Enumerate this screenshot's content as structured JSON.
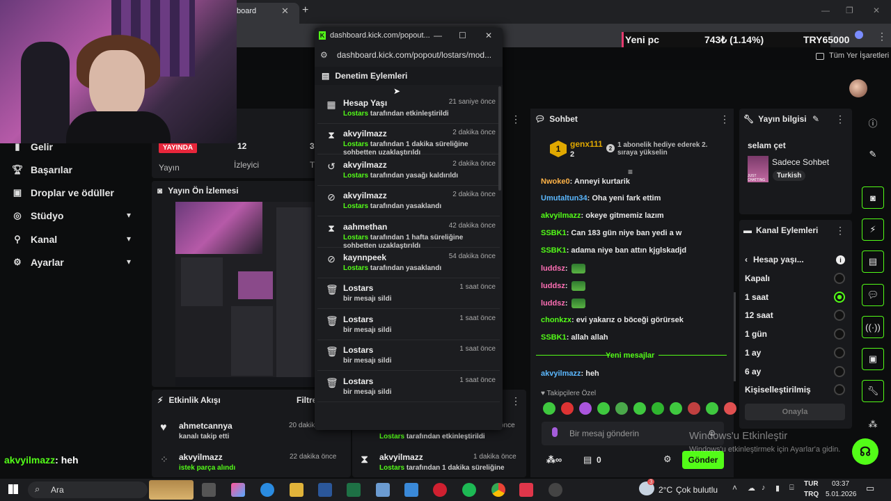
{
  "browser": {
    "tab_title": "board",
    "tab_close": "✕",
    "new_tab": "+",
    "bookmarks": "Tüm Yer İşaretleri"
  },
  "ticker": {
    "label": "Yeni pc",
    "value": "743₺ (1.14%)",
    "goal": "TRY65000"
  },
  "nav": [
    {
      "label": "Gelir",
      "icon": "income-icon"
    },
    {
      "label": "Başarılar",
      "icon": "trophy-icon"
    },
    {
      "label": "Droplar ve ödüller",
      "icon": "gift-icon"
    },
    {
      "label": "Stüdyo",
      "icon": "studio-icon"
    },
    {
      "label": "Kanal",
      "icon": "channel-icon"
    },
    {
      "label": "Ayarlar",
      "icon": "gear-icon"
    }
  ],
  "stats": {
    "live": "YAYINDA",
    "stream_label": "Yayın",
    "viewers_num": "12",
    "viewers_label": "İzleyici",
    "third_num": "3",
    "third_label": "T"
  },
  "preview": {
    "title": "Yayın Ön İzlemesi"
  },
  "activity": {
    "title": "Etkinlik Akışı",
    "filter": "Filtre",
    "items": [
      {
        "name": "ahmetcannya",
        "sub": "kanalı takip etti",
        "time": "20 dakika önce"
      },
      {
        "name": "akvyilmazz",
        "sub": "istek parça alındı",
        "time": "22 dakika önce"
      }
    ]
  },
  "overlay_chat": {
    "name": "akvyilmazz",
    "message": ": heh"
  },
  "popout": {
    "window_title": "dashboard.kick.com/popout...",
    "url": "dashboard.kick.com/popout/lostars/mod...",
    "header": "Denetim Eylemleri",
    "rows": [
      {
        "icon": "calendar-icon",
        "glyph": "▦",
        "name": "Hesap Yaşı",
        "time": "21 saniye önce",
        "actor": "Lostars",
        "sub": "tarafından etkinleştirildi"
      },
      {
        "icon": "hourglass-icon",
        "glyph": "⧗",
        "name": "akvyilmazz",
        "time": "2 dakika önce",
        "actor": "Lostars",
        "sub": "tarafından 1 dakika süreliğine sohbetten uzaklaştırıldı"
      },
      {
        "icon": "undo-icon",
        "glyph": "↺",
        "name": "akvyilmazz",
        "time": "2 dakika önce",
        "actor": "Lostars",
        "sub": "tarafından yasağı kaldırıldı"
      },
      {
        "icon": "ban-icon",
        "glyph": "⊘",
        "name": "akvyilmazz",
        "time": "2 dakika önce",
        "actor": "Lostars",
        "sub": "tarafından yasaklandı"
      },
      {
        "icon": "hourglass-icon",
        "glyph": "⧗",
        "name": "aahmethan",
        "time": "42 dakika önce",
        "actor": "Lostars",
        "sub": "tarafından 1 hafta süreliğine sohbetten uzaklaştırıldı"
      },
      {
        "icon": "ban-icon",
        "glyph": "⊘",
        "name": "kaynnpeek",
        "time": "54 dakika önce",
        "actor": "Lostars",
        "sub": "tarafından yasaklandı"
      },
      {
        "icon": "trash-icon",
        "glyph": "🗑",
        "name": "Lostars",
        "time": "1 saat önce",
        "actor": "",
        "sub": "bir mesajı sildi"
      },
      {
        "icon": "trash-icon",
        "glyph": "🗑",
        "name": "Lostars",
        "time": "1 saat önce",
        "actor": "",
        "sub": "bir mesajı sildi"
      },
      {
        "icon": "trash-icon",
        "glyph": "🗑",
        "name": "Lostars",
        "time": "1 saat önce",
        "actor": "",
        "sub": "bir mesajı sildi"
      },
      {
        "icon": "trash-icon",
        "glyph": "🗑",
        "name": "Lostars",
        "time": "1 saat önce",
        "actor": "",
        "sub": "bir mesajı sildi"
      }
    ]
  },
  "behind_popout": {
    "row1_actor": "Lostars",
    "row1_sub": "tarafından etkinleştirildi",
    "row1_time": "önce",
    "row2_name": "akvyilmazz",
    "row2_time": "1 dakika önce",
    "row2_actor": "Lostars",
    "row2_sub": "tarafından 1 dakika süreliğine"
  },
  "chat": {
    "title": "Sohbet",
    "pinned_user": "genx111",
    "pinned_rank": "1",
    "pinned_count": "2",
    "pinned_badge": "2",
    "pinned_text": "1 abonelik hediye ederek 2. sıraya yükselin",
    "messages": [
      {
        "user": "Nwoke0",
        "color": "#ffb347",
        "text": "Anneyi kurtarik",
        "emote": false
      },
      {
        "user": "Umutaltun34",
        "color": "#5bb8ff",
        "text": "Oha yeni fark ettim",
        "emote": false
      },
      {
        "user": "akvyilmazz",
        "color": "#53fc18",
        "text": "okeye gitmemiz lazım",
        "emote": false
      },
      {
        "user": "SSBK1",
        "color": "#53fc18",
        "text": "Can 183 gün niye ban yedi a w",
        "emote": false
      },
      {
        "user": "SSBK1",
        "color": "#53fc18",
        "text": "adama niye ban attın kjglskadjd",
        "emote": false
      },
      {
        "user": "luddsz",
        "color": "#ff6fb5",
        "text": "",
        "emote": true
      },
      {
        "user": "luddsz",
        "color": "#ff6fb5",
        "text": "",
        "emote": true
      },
      {
        "user": "luddsz",
        "color": "#ff6fb5",
        "text": "",
        "emote": true
      },
      {
        "user": "chonkzx",
        "color": "#53fc18",
        "text": "evi yakarız o böceği görürsek",
        "emote": false
      },
      {
        "user": "SSBK1",
        "color": "#53fc18",
        "text": "allah allah",
        "emote": false
      }
    ],
    "new_messages": "Yeni mesajlar",
    "last": {
      "user": "akvyilmazz",
      "color": "#5bb8ff",
      "text": "heh"
    },
    "followers_only": "Takipçilere Özel",
    "input_placeholder": "Bir mesaj gönderin",
    "count": "0",
    "send": "Gönder"
  },
  "info": {
    "title": "Yayın bilgisi",
    "stream_title": "selam çet",
    "category": "Sadece Sohbet",
    "language": "Turkish",
    "thumb_label": "JUST CHATTING"
  },
  "channel_actions": {
    "title": "Kanal Eylemleri",
    "sub_title": "Hesap yaşı...",
    "options": [
      "Kapalı",
      "1 saat",
      "12 saat",
      "1 gün",
      "1 ay",
      "6 ay",
      "Kişiselleştirilmiş"
    ],
    "selected": "1 saat",
    "confirm": "Onayla"
  },
  "watermark": {
    "line1": "Windows'u Etkinleştir",
    "line2": "Windows'u etkinleştirmek için Ayarlar'a gidin."
  },
  "taskbar": {
    "search": "Ara",
    "temperature": "2°C",
    "weather": "Çok bulutlu",
    "weather_badge": "3",
    "lang1": "TUR",
    "lang2": "TRQ",
    "time": "03:37",
    "date": "5.01.2026"
  },
  "colors": {
    "accent": "#53fc18",
    "live": "#e8263b",
    "panel": "#18191c"
  }
}
